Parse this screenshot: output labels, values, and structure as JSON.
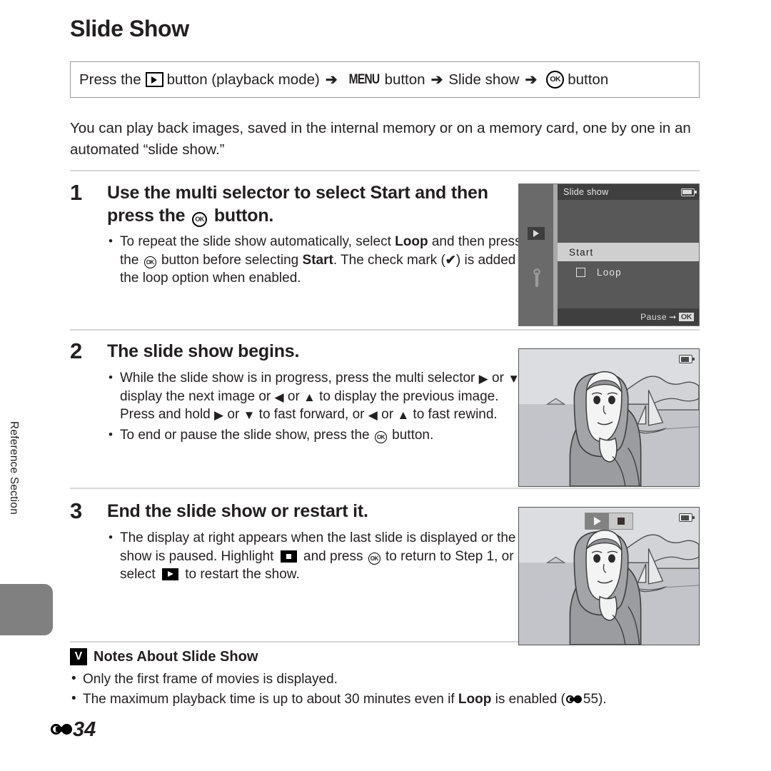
{
  "sidebar": {
    "section_label": "Reference Section"
  },
  "page": {
    "title": "Slide Show",
    "footer_number": "34"
  },
  "path_bar": {
    "prefix": "Press the",
    "after_play": "button (playback mode)",
    "menu_label": "MENU",
    "after_menu": "button",
    "item": "Slide show",
    "after_item": "button",
    "ok_label": "OK",
    "arrow": "➔"
  },
  "intro": "You can play back images, saved in the internal memory or on a memory card, one by one in an automated “slide show.”",
  "steps": [
    {
      "number": "1",
      "heading_part1": "Use the multi selector to select ",
      "heading_bold": "Start",
      "heading_part2": " and then press the ",
      "heading_part3": " button.",
      "bullets": [
        {
          "t1": "To repeat the slide show automatically, select ",
          "b1": "Loop",
          "t2": " and then press the ",
          "t3": " button before selecting ",
          "b2": "Start",
          "t4": ". The check mark (",
          "t5": ") is added to the loop option when enabled."
        }
      ]
    },
    {
      "number": "2",
      "heading": "The slide show begins.",
      "bullets": [
        {
          "t1": "While the slide show is in progress, press the multi selector ",
          "t2": " or ",
          "t3": " to display the next image or ",
          "t4": " or ",
          "t5": " to display the previous image. Press and hold ",
          "t6": " or ",
          "t7": " to fast forward, or ",
          "t8": " or ",
          "t9": " to fast rewind."
        },
        {
          "t1": "To end or pause the slide show, press the ",
          "t2": " button."
        }
      ]
    },
    {
      "number": "3",
      "heading": "End the slide show or restart it.",
      "bullets": [
        {
          "t1": "The display at right appears when the last slide is displayed or the show is paused. Highlight ",
          "t2": " and press ",
          "t3": " to return to Step 1, or select ",
          "t4": " to restart the show."
        }
      ]
    }
  ],
  "camera_screen": {
    "menu_title": "Slide show",
    "option_start": "Start",
    "option_loop": "Loop",
    "footer_text": "Pause",
    "footer_arrow": "➡",
    "footer_ok": "OK",
    "icons": {
      "playback_tab": "playback-tab-icon",
      "setup_tab": "wrench-icon",
      "battery": "battery-icon",
      "checkbox": "checkbox-unchecked-icon"
    }
  },
  "photo_overlays": {
    "play_icon": "play-icon",
    "stop_icon": "stop-icon",
    "battery_icon": "battery-icon"
  },
  "notes": {
    "title": "Notes About Slide Show",
    "badge": "V",
    "items": [
      {
        "text": "Only the first frame of movies is displayed."
      },
      {
        "t1": "The maximum playback time is up to about 30 minutes even if ",
        "b1": "Loop",
        "t2": " is enabled (",
        "ref": "55",
        "t3": ")."
      }
    ]
  },
  "colors": {
    "rule": "#d7d7d7",
    "box_border": "#9b9b9b",
    "tab_gray": "#808080",
    "lcd_bg": "#585858",
    "lcd_tab": "#6a6a6a",
    "lcd_title_bar": "#3f3f3f",
    "lcd_highlight": "#cfcfcf",
    "text": "#231f20"
  }
}
